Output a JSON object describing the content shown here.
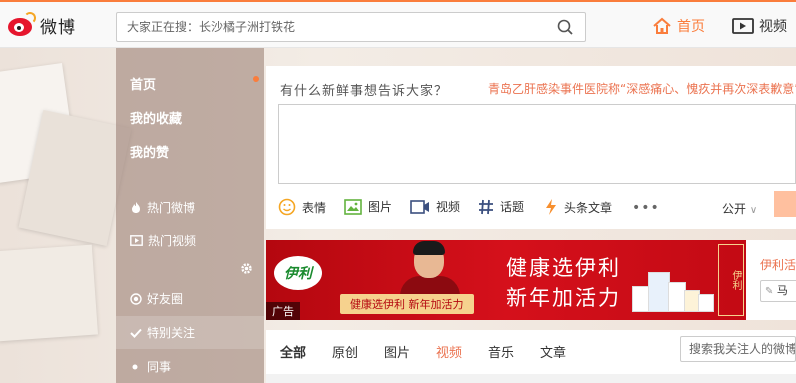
{
  "header": {
    "logo_text": "微博",
    "search_placeholder": "大家正在搜：长沙橘子洲打铁花",
    "nav_home": "首页",
    "nav_video": "视频",
    "accent_color": "#fa7d3c"
  },
  "sidebar": {
    "items": [
      {
        "label": "首页"
      },
      {
        "label": "我的收藏"
      },
      {
        "label": "我的赞"
      },
      {
        "label": "热门微博",
        "icon": "flame-icon"
      },
      {
        "label": "热门视频",
        "icon": "video-icon"
      },
      {
        "label": "好友圈",
        "icon": "circle-icon"
      },
      {
        "label": "特别关注",
        "icon": "check-icon"
      },
      {
        "label": "同事",
        "icon": "dot-icon"
      }
    ]
  },
  "composer": {
    "title": "有什么新鲜事想告诉大家？",
    "trend": "青岛乙肝感染事件医院称“深感痛心、愧疚并再次深表歉意”",
    "tools": {
      "emoji": "表情",
      "image": "图片",
      "video": "视频",
      "topic": "话题",
      "article": "头条文章"
    },
    "more": "•••",
    "visibility": "公开"
  },
  "banner": {
    "brand": "伊利",
    "headline1": "健康选伊利",
    "headline2": "新年加活力",
    "slogan": "健康选伊利 新年加活力",
    "ad_tag": "广告",
    "seal": "伊利",
    "side_title": "伊利活",
    "side_button": "马"
  },
  "feed": {
    "tabs": [
      "全部",
      "原创",
      "图片",
      "视频",
      "音乐",
      "文章"
    ],
    "search_placeholder": "搜索我关注人的微博"
  }
}
